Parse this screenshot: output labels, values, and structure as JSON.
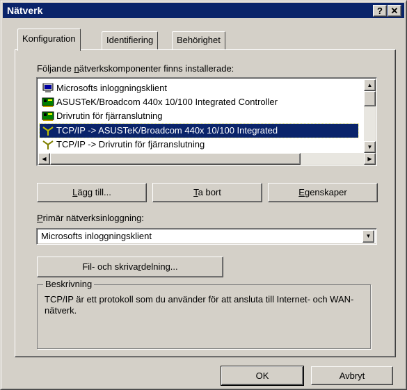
{
  "window": {
    "title": "Nätverk",
    "help_button": "?",
    "close_button": "✕"
  },
  "tabs": [
    {
      "label": "Konfiguration",
      "active": true
    },
    {
      "label": "Identifiering",
      "active": false
    },
    {
      "label": "Behörighet",
      "active": false
    }
  ],
  "components": {
    "label_pre": "Följande ",
    "label_key": "n",
    "label_post": "ätverkskomponenter finns installerade:",
    "items": [
      {
        "label": "Microsofts inloggningsklient",
        "icon": "monitor-icon",
        "selected": false
      },
      {
        "label": "ASUSTeK/Broadcom 440x 10/100 Integrated Controller",
        "icon": "network-card-icon",
        "selected": false
      },
      {
        "label": "Drivrutin för fjärranslutning",
        "icon": "network-card-icon",
        "selected": false
      },
      {
        "label": "TCP/IP -> ASUSTeK/Broadcom 440x 10/100 Integrated",
        "icon": "protocol-icon",
        "selected": true
      },
      {
        "label": "TCP/IP -> Drivrutin för fjärranslutning",
        "icon": "protocol-icon",
        "selected": false
      }
    ]
  },
  "buttons": {
    "add_key": "L",
    "add_rest": "ägg till...",
    "remove_key": "T",
    "remove_rest": "a bort",
    "properties_key": "E",
    "properties_rest": "genskaper",
    "file_share_pre": "Fil- och skriva",
    "file_share_key": "r",
    "file_share_post": "delning...",
    "ok": "OK",
    "cancel": "Avbryt"
  },
  "primary_logon": {
    "label_key": "P",
    "label_rest": "rimär nätverksinloggning:",
    "value": "Microsofts inloggningsklient"
  },
  "description": {
    "title": "Beskrivning",
    "text": "TCP/IP är ett protokoll som du använder för att ansluta till Internet- och WAN-nätverk."
  },
  "colors": {
    "face": "#d4d0c8",
    "title_bar": "#0a246a",
    "selection": "#0a246a"
  }
}
